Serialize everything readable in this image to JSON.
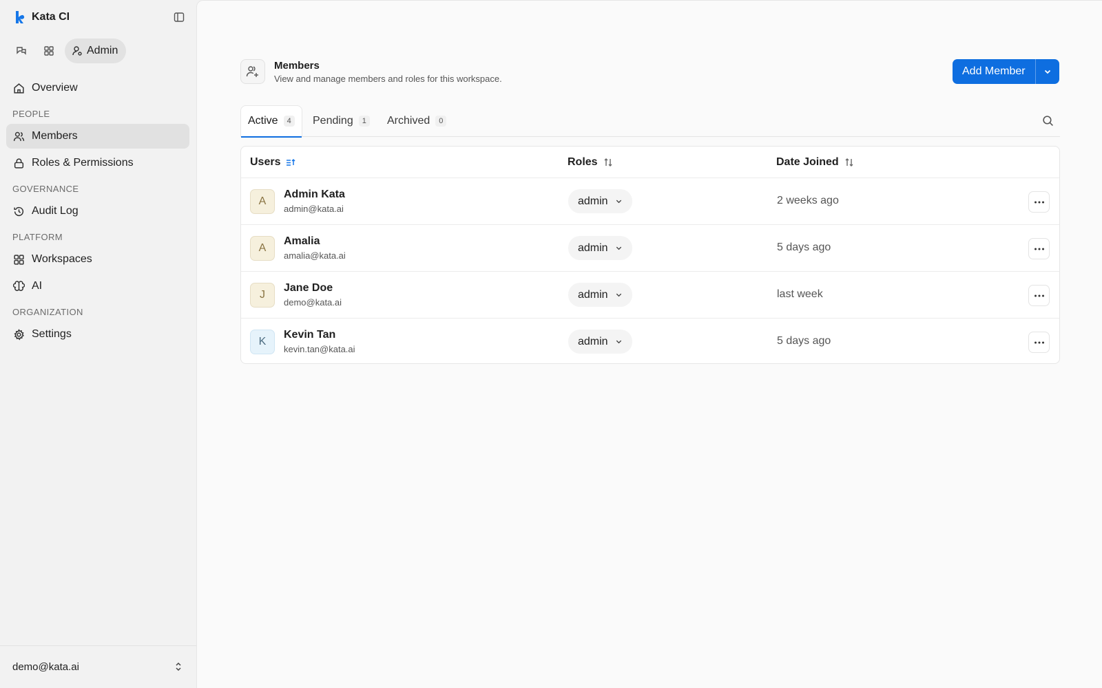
{
  "app": {
    "title": "Kata CI"
  },
  "modes": {
    "active_label": "Admin"
  },
  "nav": {
    "overview": "Overview",
    "section_people": "PEOPLE",
    "members": "Members",
    "roles": "Roles & Permissions",
    "section_governance": "GOVERNANCE",
    "audit_log": "Audit Log",
    "section_platform": "PLATFORM",
    "workspaces": "Workspaces",
    "ai": "AI",
    "section_organization": "ORGANIZATION",
    "settings": "Settings"
  },
  "account": {
    "email": "demo@kata.ai"
  },
  "page": {
    "title": "Members",
    "description": "View and manage members and roles for this workspace.",
    "add_label": "Add Member"
  },
  "tabs": [
    {
      "label": "Active",
      "count": "4"
    },
    {
      "label": "Pending",
      "count": "1"
    },
    {
      "label": "Archived",
      "count": "0"
    }
  ],
  "table": {
    "headers": {
      "users": "Users",
      "roles": "Roles",
      "date_joined": "Date Joined"
    },
    "rows": [
      {
        "initial": "A",
        "name": "Admin Kata",
        "email": "admin@kata.ai",
        "role": "admin",
        "joined": "2 weeks ago"
      },
      {
        "initial": "A",
        "name": "Amalia",
        "email": "amalia@kata.ai",
        "role": "admin",
        "joined": "5 days ago"
      },
      {
        "initial": "J",
        "name": "Jane Doe",
        "email": "demo@kata.ai",
        "role": "admin",
        "joined": "last week"
      },
      {
        "initial": "K",
        "name": "Kevin Tan",
        "email": "kevin.tan@kata.ai",
        "role": "admin",
        "joined": "5 days ago"
      }
    ]
  },
  "colors": {
    "accent": "#0e6ee0",
    "sidebar_bg": "#f2f2f2",
    "main_bg": "#fafafa"
  },
  "icons": {
    "brand": "kata-logo-icon",
    "collapse": "sidebar-toggle-icon",
    "modes": [
      "chat-icon",
      "grid-icon",
      "user-icon"
    ],
    "nav": [
      "home-icon",
      "users-icon",
      "lock-icon",
      "history-icon",
      "grid-icon",
      "brain-icon",
      "gear-icon"
    ]
  }
}
